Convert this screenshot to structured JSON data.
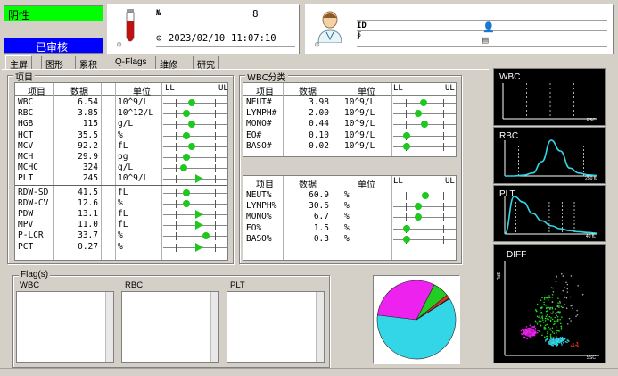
{
  "status": {
    "result": "阴性",
    "review": "已审核"
  },
  "sample": {
    "no_label": "№",
    "no_value": "8",
    "date": "2023/02/10",
    "time": "11:07:10"
  },
  "patient": {
    "id_label": "ID"
  },
  "tabs": [
    {
      "label": "主屏",
      "active": true
    },
    {
      "label": "图形",
      "active": false
    },
    {
      "label": "累积",
      "active": false
    },
    {
      "label": "Q-Flags",
      "active": false
    },
    {
      "label": "维修",
      "active": false
    },
    {
      "label": "研究",
      "active": false
    }
  ],
  "items_panel": {
    "title": "项目",
    "headers": {
      "item": "项目",
      "value": "数据",
      "unit": "单位",
      "ll": "LL",
      "ul": "UL"
    },
    "rows": [
      {
        "name": "WBC",
        "value": "6.54",
        "unit": "10^9/L",
        "pos": 0.45,
        "mark": "dot"
      },
      {
        "name": "RBC",
        "value": "3.85",
        "unit": "10^12/L",
        "pos": 0.36,
        "mark": "dot"
      },
      {
        "name": "HGB",
        "value": "115",
        "unit": "g/L",
        "pos": 0.45,
        "mark": "dot"
      },
      {
        "name": "HCT",
        "value": "35.5",
        "unit": "%",
        "pos": 0.36,
        "mark": "dot"
      },
      {
        "name": "MCV",
        "value": "92.2",
        "unit": "fL",
        "pos": 0.45,
        "mark": "dot"
      },
      {
        "name": "MCH",
        "value": "29.9",
        "unit": "pg",
        "pos": 0.36,
        "mark": "dot"
      },
      {
        "name": "MCHC",
        "value": "324",
        "unit": "g/L",
        "pos": 0.32,
        "mark": "dot"
      },
      {
        "name": "PLT",
        "value": "245",
        "unit": "10^9/L",
        "pos": 0.55,
        "mark": "tri"
      },
      {
        "name": "RDW-SD",
        "value": "41.5",
        "unit": "fL",
        "pos": 0.36,
        "mark": "dot"
      },
      {
        "name": "RDW-CV",
        "value": "12.6",
        "unit": "%",
        "pos": 0.36,
        "mark": "dot"
      },
      {
        "name": "PDW",
        "value": "13.1",
        "unit": "fL",
        "pos": 0.55,
        "mark": "tri"
      },
      {
        "name": "MPV",
        "value": "11.0",
        "unit": "fL",
        "pos": 0.55,
        "mark": "tri"
      },
      {
        "name": "P-LCR",
        "value": "33.7",
        "unit": "%",
        "pos": 0.66,
        "mark": "dot"
      },
      {
        "name": "PCT",
        "value": "0.27",
        "unit": "%",
        "pos": 0.55,
        "mark": "tri"
      }
    ]
  },
  "wbc_panel": {
    "title": "WBC分类",
    "headers": {
      "item": "项目",
      "value": "数据",
      "unit": "单位",
      "ll": "LL",
      "ul": "UL"
    },
    "abs_rows": [
      {
        "name": "NEUT#",
        "value": "3.98",
        "unit": "10^9/L",
        "pos": 0.48,
        "mark": "dot"
      },
      {
        "name": "LYMPH#",
        "value": "2.00",
        "unit": "10^9/L",
        "pos": 0.4,
        "mark": "dot"
      },
      {
        "name": "MONO#",
        "value": "0.44",
        "unit": "10^9/L",
        "pos": 0.5,
        "mark": "dot"
      },
      {
        "name": "EO#",
        "value": "0.10",
        "unit": "10^9/L",
        "pos": 0.22,
        "mark": "dot"
      },
      {
        "name": "BASO#",
        "value": "0.02",
        "unit": "10^9/L",
        "pos": 0.22,
        "mark": "dot"
      }
    ],
    "pct_rows": [
      {
        "name": "NEUT%",
        "value": "60.9",
        "unit": "%",
        "pos": 0.52,
        "mark": "dot"
      },
      {
        "name": "LYMPH%",
        "value": "30.6",
        "unit": "%",
        "pos": 0.4,
        "mark": "dot"
      },
      {
        "name": "MONO%",
        "value": "6.7",
        "unit": "%",
        "pos": 0.4,
        "mark": "dot"
      },
      {
        "name": "EO%",
        "value": "1.5",
        "unit": "%",
        "pos": 0.22,
        "mark": "dot"
      },
      {
        "name": "BASO%",
        "value": "0.3",
        "unit": "%",
        "pos": 0.22,
        "mark": "dot"
      }
    ]
  },
  "flags": {
    "title": "Flag(s)",
    "wbc": "WBC",
    "rbc": "RBC",
    "plt": "PLT"
  },
  "chart_data": [
    {
      "type": "pie",
      "values": [
        60.9,
        30.6,
        6.7,
        1.5,
        0.3
      ],
      "colors": [
        "#33d6e6",
        "#ee22ee",
        "#22cc22",
        "#e03020",
        "#2040e0"
      ]
    },
    {
      "type": "scatter",
      "title": "WBC",
      "xlabel": "FSC"
    },
    {
      "type": "line",
      "title": "RBC",
      "xlabel": "250 fL",
      "x": [
        0,
        10,
        20,
        30,
        40,
        50,
        60,
        70,
        80,
        90,
        100
      ],
      "values": [
        0,
        0,
        2,
        8,
        40,
        100,
        70,
        22,
        8,
        3,
        1
      ]
    },
    {
      "type": "line",
      "title": "PLT",
      "xlabel": "40 fL",
      "x": [
        0,
        10,
        20,
        30,
        40,
        50,
        60,
        70,
        80,
        90,
        100
      ],
      "values": [
        0,
        100,
        85,
        55,
        35,
        22,
        14,
        9,
        6,
        4,
        2
      ]
    },
    {
      "type": "scatter",
      "title": "DIFF",
      "xlabel": "SSC",
      "ylabel": "SFL"
    }
  ],
  "colors": {
    "negative_bg": "#00ff00",
    "review_bg": "#0000ff",
    "marker": "#1ec81e",
    "curve": "#33d6e6"
  }
}
